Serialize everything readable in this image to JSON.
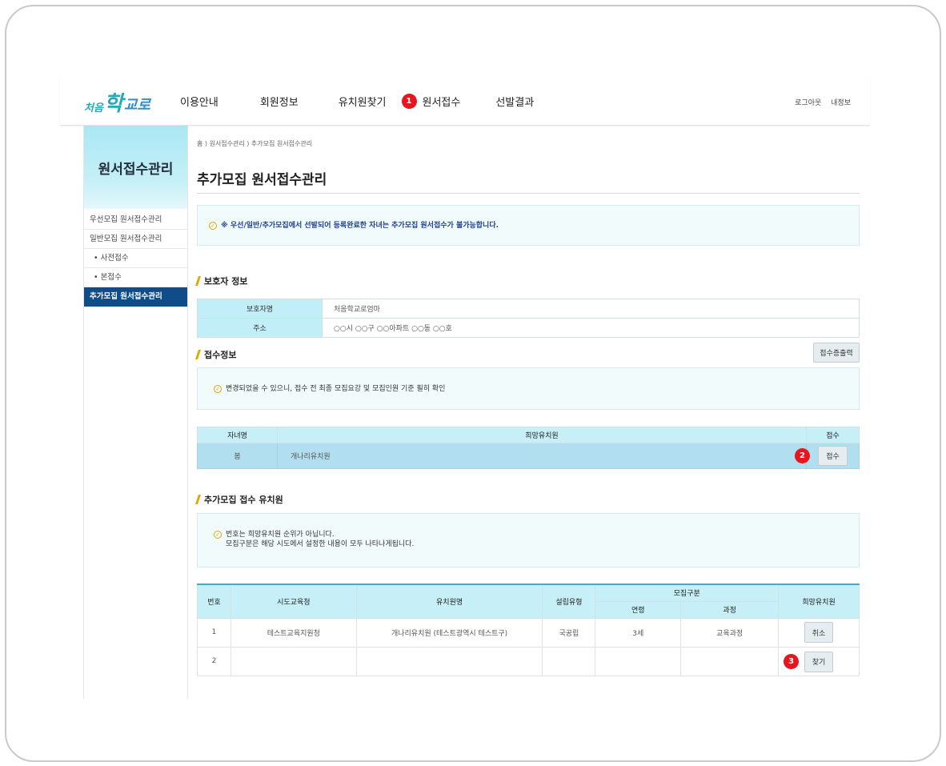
{
  "header": {
    "logo": {
      "part1": "처음",
      "part2": "학",
      "part3": "교로"
    },
    "nav": [
      {
        "label": "이용안내"
      },
      {
        "label": "회원정보"
      },
      {
        "label": "유치원찾기"
      },
      {
        "label": "원서접수",
        "badge": "1"
      },
      {
        "label": "선발결과"
      }
    ],
    "util": {
      "logout": "로그아웃",
      "myinfo": "내정보"
    }
  },
  "sidebar": {
    "title": "원서접수관리",
    "items": [
      {
        "label": "우선모집 원서접수관리"
      },
      {
        "label": "일반모집 원서접수관리"
      },
      {
        "label": "• 사전접수"
      },
      {
        "label": "• 본접수"
      },
      {
        "label": "추가모집 원서접수관리"
      }
    ]
  },
  "content": {
    "breadcrumb": "홈 ) 원서접수관리 ) 추가모집 원서접수관리",
    "title": "추가모집 원서접수관리",
    "notice_top": "※ 우선/일반/추가모집에서 선발되어 등록완료한 자녀는 추가모집 원서접수가 불가능합니다.",
    "guardian": {
      "section_title": "보호자 정보",
      "rows": [
        {
          "label": "보호자명",
          "value": "처음학교로엄마"
        },
        {
          "label": "주소",
          "value": "○○시 ○○구 ○○아파트 ○○동 ○○호"
        }
      ]
    },
    "apply": {
      "section_title": "접수정보",
      "print_button": "접수증출력",
      "notice": "변경되었을 수 있으니, 접수 전 최종 모집요강 및 모집인원 기준 필히 확인",
      "headers": {
        "child": "자녀명",
        "kindergarten": "희망유치원",
        "action": "접수"
      },
      "row": {
        "child": "봄",
        "kindergarten": "개나리유치원",
        "badge": "2",
        "button": "접수"
      }
    },
    "extra": {
      "section_title": "추가모집 접수 유치원",
      "notice_line1": "번호는 희망유치원 순위가 아닙니다.",
      "notice_line2": "모집구분은 해당 시도에서 설정한 내용이 모두 나타나게됩니다.",
      "headers": {
        "no": "번호",
        "office": "시도교육청",
        "name": "유치원명",
        "type": "설립유형",
        "recruit": "모집구분",
        "age": "연령",
        "course": "과정",
        "wish": "희망유치원"
      },
      "rows": [
        {
          "no": "1",
          "office": "테스트교육지원청",
          "name": "개나리유치원 (테스트광역시 테스트구)",
          "type": "국공립",
          "age": "3세",
          "course": "교육과정",
          "button": "취소"
        },
        {
          "no": "2",
          "office": "",
          "name": "",
          "type": "",
          "age": "",
          "course": "",
          "badge": "3",
          "button": "찾기"
        }
      ]
    }
  }
}
